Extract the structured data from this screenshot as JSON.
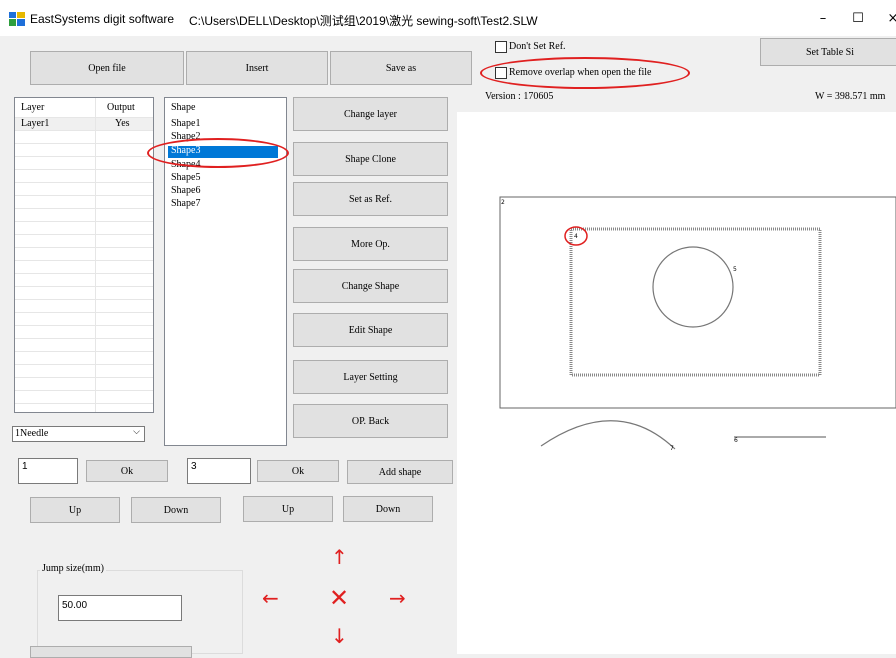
{
  "window": {
    "title": "EastSystems digit software",
    "path": "C:\\Users\\DELL\\Desktop\\测试组\\2019\\激光 sewing-soft\\Test2.SLW",
    "minimize": "–",
    "maximize": "☐",
    "close": "×"
  },
  "toolbar": {
    "open_file": "Open file",
    "insert": "Insert",
    "save_as": "Save as",
    "set_table_size": "Set Table Si"
  },
  "options": {
    "dont_set_ref": "Don't Set Ref.",
    "remove_overlap": "Remove overlap when open the file",
    "version": "Version : 170605",
    "width_readout": "W = 398.571 mm"
  },
  "layer_list": {
    "col_layer": "Layer",
    "col_output": "Output",
    "rows": [
      {
        "layer": "Layer1",
        "output": "Yes"
      }
    ]
  },
  "shape_list": {
    "header": "Shape",
    "items": [
      "Shape1",
      "Shape2",
      "Shape3",
      "Shape4",
      "Shape5",
      "Shape6",
      "Shape7"
    ],
    "selected": "Shape3"
  },
  "side_buttons": {
    "change_layer": "Change layer",
    "shape_clone": "Shape Clone",
    "set_as_ref": "Set as Ref.",
    "more_op": "More Op.",
    "change_shape": "Change Shape",
    "edit_shape": "Edit Shape",
    "layer_setting": "Layer Setting",
    "op_back": "OP. Back"
  },
  "needle_select": {
    "value": "1Needle"
  },
  "layer_controls": {
    "input_value": "1",
    "ok": "Ok",
    "up": "Up",
    "down": "Down"
  },
  "shape_controls": {
    "input_value": "3",
    "ok": "Ok",
    "add_shape": "Add shape",
    "up": "Up",
    "down": "Down"
  },
  "jump": {
    "label": "Jump size(mm)",
    "value": "50.00"
  },
  "canvas_labels": {
    "outer": "2",
    "inner": "4",
    "circle": "5",
    "arc": "7",
    "line": "6"
  },
  "colors": {
    "selection": "#0078d7",
    "annotation": "#e02020",
    "jog_arrows": "#e02020"
  }
}
